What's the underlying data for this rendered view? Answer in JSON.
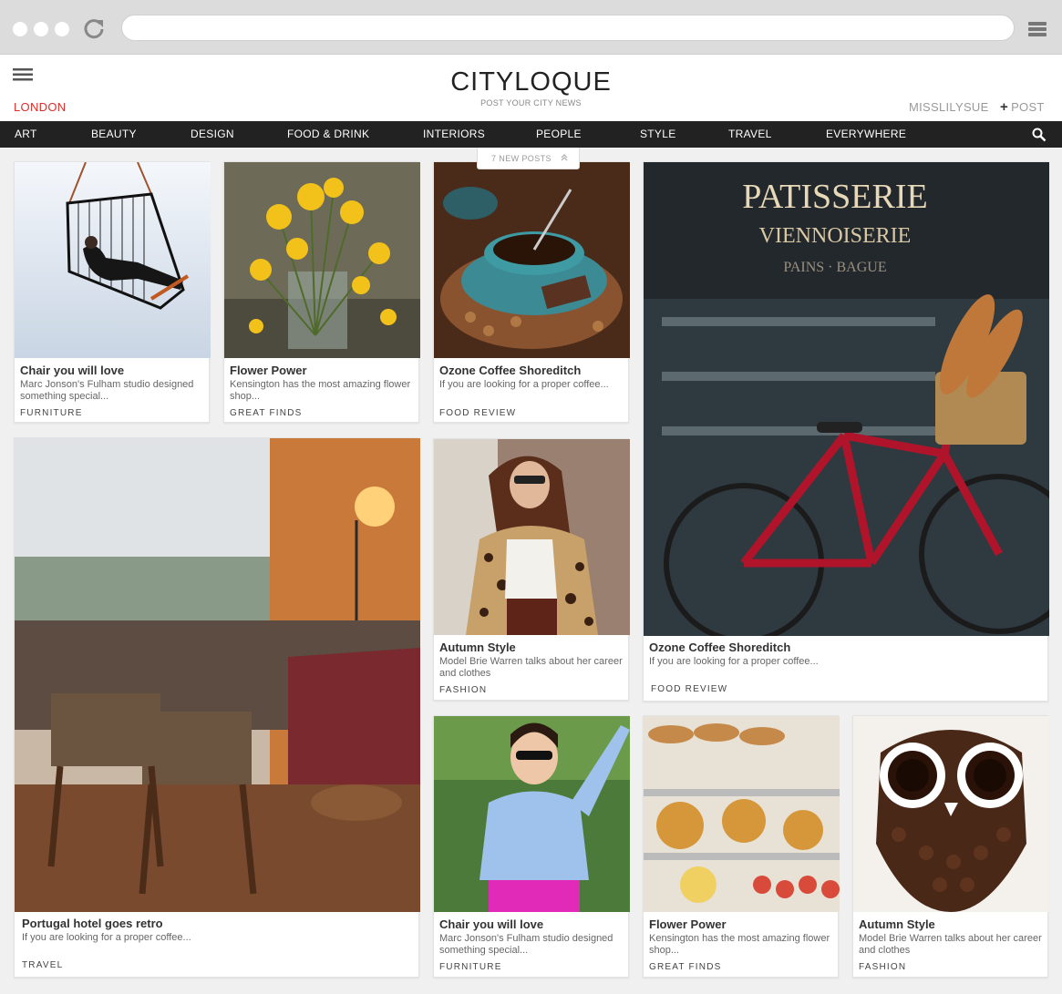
{
  "site": {
    "logo": "CITYLOQUE",
    "tagline": "POST YOUR CITY NEWS",
    "city": "LONDON",
    "username": "MISSLILYSUE",
    "post_label": "POST",
    "post_plus": "+"
  },
  "nav": {
    "categories": [
      "ART",
      "BEAUTY",
      "DESIGN",
      "FOOD & DRINK",
      "INTERIORS",
      "PEOPLE",
      "STYLE",
      "TRAVEL",
      "EVERYWHERE"
    ]
  },
  "new_posts": "7 NEW POSTS",
  "cards": [
    {
      "title": "Chair you will love",
      "desc": "Marc Jonson's Fulham studio designed something special...",
      "category": "FURNITURE"
    },
    {
      "title": "Flower Power",
      "desc": "Kensington has the most amazing flower shop...",
      "category": "GREAT FINDS"
    },
    {
      "title": "Ozone Coffee Shoreditch",
      "desc": "If you are looking for a proper coffee...",
      "category": "FOOD REVIEW"
    },
    {
      "title": "Ozone Coffee Shoreditch",
      "desc": "If you are looking for a proper coffee...",
      "category": "FOOD REVIEW",
      "sign_line1": "PATISSERIE",
      "sign_line2": "VIENNOISERIE",
      "sign_line3": "PAINS · BAGUE"
    },
    {
      "title": "Portugal hotel goes retro",
      "desc": "If you are looking for a proper coffee...",
      "category": "TRAVEL"
    },
    {
      "title": "Autumn Style",
      "desc": "Model Brie Warren talks about her career and clothes",
      "category": "FASHION"
    },
    {
      "title": "Chair you will love",
      "desc": "Marc Jonson's Fulham studio designed something special...",
      "category": "FURNITURE"
    },
    {
      "title": "Flower Power",
      "desc": "Kensington has the most amazing flower shop...",
      "category": "GREAT FINDS"
    },
    {
      "title": "Autumn Style",
      "desc": "Model Brie Warren talks about her career and clothes",
      "category": "FASHION"
    }
  ],
  "colors": {
    "accent": "#d9302c",
    "nav_bg": "#222222",
    "page_bg": "#f0f0f0"
  },
  "icons": [
    "reload-icon",
    "menu-icon",
    "hamburger-icon",
    "search-icon",
    "chevron-up-icon"
  ]
}
